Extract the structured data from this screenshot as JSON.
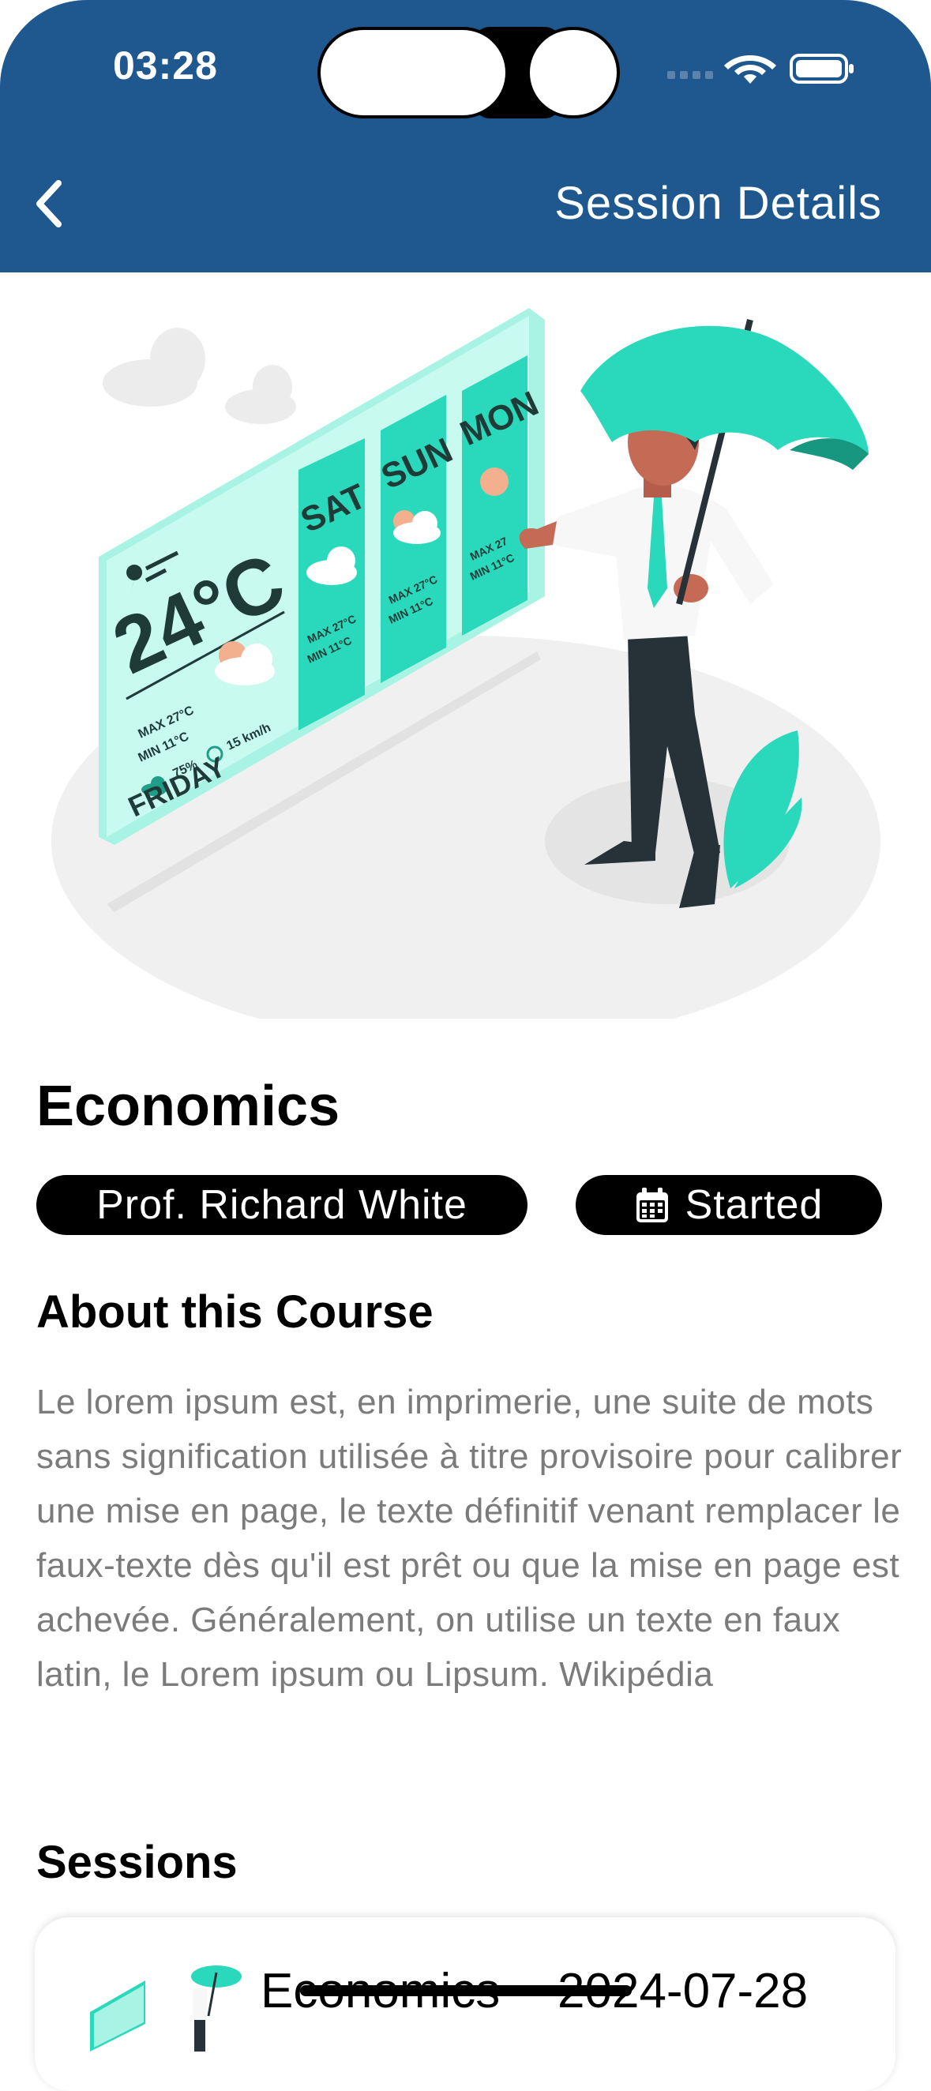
{
  "status_bar": {
    "time": "03:28"
  },
  "header": {
    "title": "Session Details"
  },
  "hero": {
    "weather_card": {
      "temp": "24°C",
      "max": "MAX 27°C",
      "min": "MIN 11°C",
      "humidity": "75%",
      "wind": "15 km/h",
      "day": "FRIDAY",
      "forecast": [
        {
          "day": "SAT",
          "max": "MAX 27°C",
          "min": "MIN 11°C"
        },
        {
          "day": "SUN",
          "max": "MAX 27°C",
          "min": "MIN 11°C"
        },
        {
          "day": "MON",
          "max": "MAX 27",
          "min": "MIN 11°C"
        }
      ]
    }
  },
  "course": {
    "title": "Economics",
    "professor": "Prof. Richard White",
    "status": "Started",
    "about_heading": "About this Course",
    "about_text": "Le lorem ipsum est, en imprimerie, une suite de mots sans signification utilisée à titre provisoire pour calibrer une mise en page, le texte définitif venant remplacer le faux-texte dès qu'il est prêt ou que la mise en page est achevée. Généralement, on utilise un texte en faux latin, le Lorem ipsum ou Lipsum. Wikipédia"
  },
  "sessions": {
    "heading": "Sessions",
    "items": [
      {
        "name": "Economics",
        "date": "2024-07-28"
      }
    ]
  },
  "colors": {
    "header_bg": "#1f588f",
    "accent": "#00d7b0",
    "chip_bg": "#000000"
  }
}
